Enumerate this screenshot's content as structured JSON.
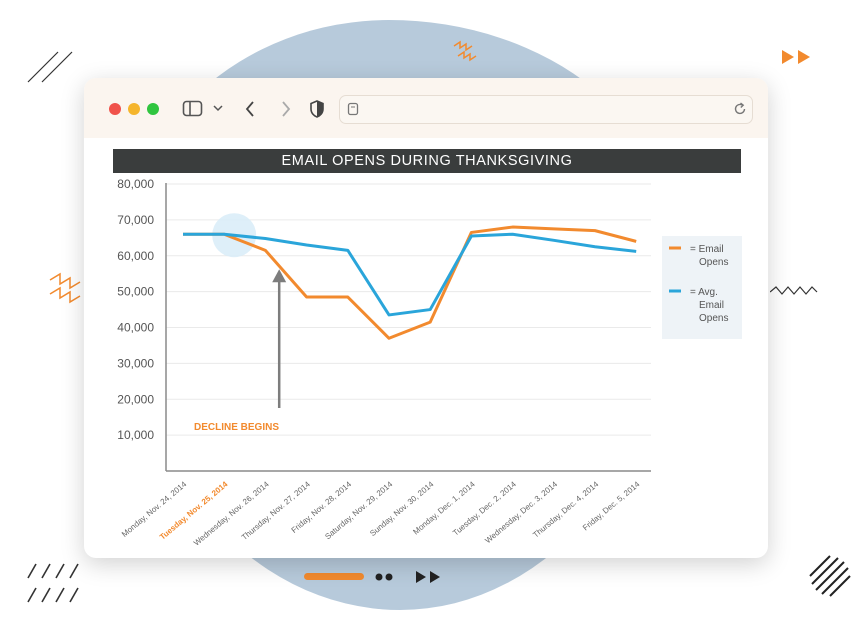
{
  "window": {
    "controls": [
      "close",
      "minimize",
      "maximize"
    ],
    "toolbar_icons": [
      "sidebar-icon",
      "chevron-down-icon",
      "back-icon",
      "forward-icon",
      "shield-icon",
      "page-icon",
      "reload-icon"
    ]
  },
  "colors": {
    "email_opens": "#f28a2e",
    "avg_email_opens": "#2aa5da",
    "title_bar": "#3a3d3d",
    "annotation": "#f28a2e"
  },
  "chart_data": {
    "type": "line",
    "title": "EMAIL OPENS DURING THANKSGIVING",
    "categories": [
      "Monday, Nov. 24, 2014",
      "Tuesday, Nov. 25, 2014",
      "Wednesday, Nov. 26, 2014",
      "Thursday, Nov. 27, 2014",
      "Friday, Nov. 28, 2014",
      "Saturday, Nov. 29, 2014",
      "Sunday, Nov. 30, 2014",
      "Monday, Dec. 1, 2014",
      "Tuesday, Dec. 2, 2014",
      "Wednesday, Dec. 3, 2014",
      "Thursday, Dec. 4, 2014",
      "Friday, Dec. 5, 2014"
    ],
    "highlight_category_index": 1,
    "y_ticks": [
      "10,000",
      "20,000",
      "30,000",
      "40,000",
      "50,000",
      "60,000",
      "70,000",
      "80,000"
    ],
    "ylim": [
      0,
      80000
    ],
    "grid": true,
    "series": [
      {
        "name": "= Email Opens",
        "values": [
          66000,
          66000,
          61500,
          48500,
          48500,
          37000,
          41500,
          66500,
          68000,
          67500,
          67000,
          64000
        ]
      },
      {
        "name": "= Avg. Email Opens",
        "values": [
          66000,
          66000,
          64800,
          63000,
          61500,
          43500,
          45000,
          65500,
          66000,
          64300,
          62500,
          61200
        ]
      }
    ],
    "legend": {
      "placement": "right",
      "entries": [
        "= Email Opens",
        "= Avg. Email Opens"
      ]
    },
    "annotation": {
      "text": "DECLINE BEGINS",
      "category_index": 1,
      "value": 66000
    }
  }
}
